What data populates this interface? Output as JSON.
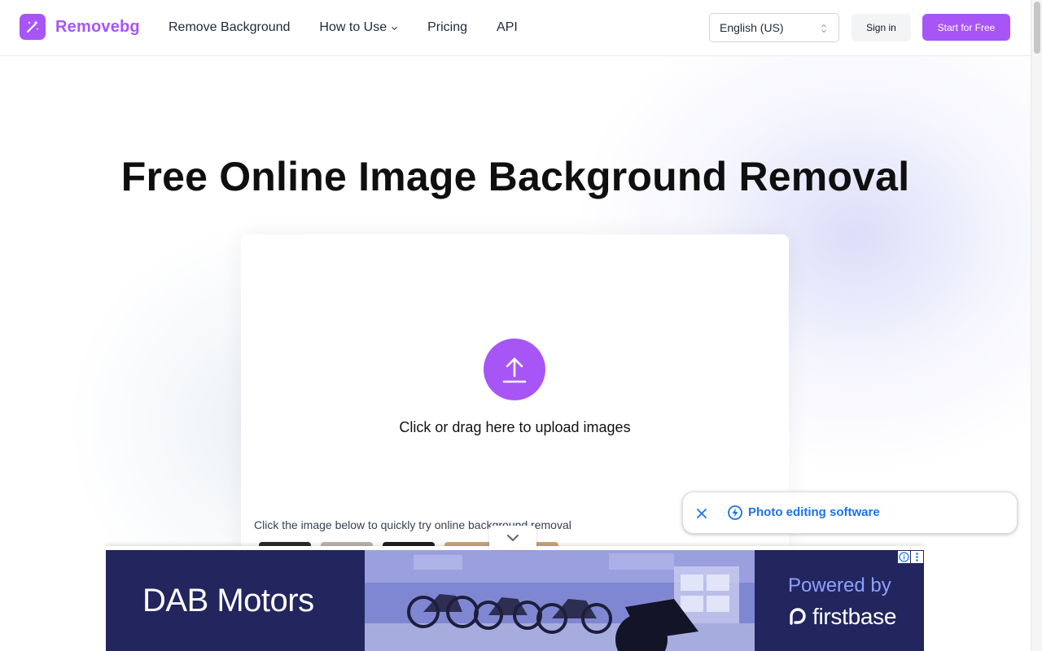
{
  "app": {
    "logo_text": "Removebg",
    "brand_color": "#a855f7"
  },
  "nav": {
    "items": [
      {
        "label": "Remove Background",
        "has_dropdown": false
      },
      {
        "label": "How to Use",
        "has_dropdown": true
      },
      {
        "label": "Pricing",
        "has_dropdown": false
      },
      {
        "label": "API",
        "has_dropdown": false
      }
    ]
  },
  "language": {
    "selected": "English (US)"
  },
  "auth": {
    "signin_label": "Sign in",
    "start_label": "Start for Free"
  },
  "hero": {
    "title": "Free Online Image Background Removal"
  },
  "upload": {
    "prompt": "Click or drag here to upload images",
    "sample_hint": "Click the image below to quickly try online background removal"
  },
  "toast": {
    "label": "Photo editing software",
    "icon": "bolt-icon"
  },
  "ad": {
    "brand": "DAB Motors",
    "powered_by": "Powered by",
    "sponsor": "firstbase",
    "background": "#23255e"
  }
}
